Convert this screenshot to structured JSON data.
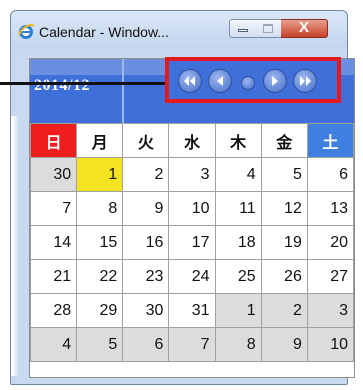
{
  "window": {
    "title": "Calendar - Window...",
    "controls": {
      "minimize": "minimize",
      "maximize": "maximize",
      "close": "X"
    }
  },
  "calendar": {
    "month_label": "2014/12",
    "nav": [
      "first-icon",
      "previous-icon",
      "today-dot-icon",
      "next-icon",
      "last-icon"
    ],
    "weekdays": [
      "日",
      "月",
      "火",
      "水",
      "木",
      "金",
      "土"
    ],
    "weeks": [
      [
        "30",
        "1",
        "2",
        "3",
        "4",
        "5",
        "6"
      ],
      [
        "7",
        "8",
        "9",
        "10",
        "11",
        "12",
        "13"
      ],
      [
        "14",
        "15",
        "16",
        "17",
        "18",
        "19",
        "20"
      ],
      [
        "21",
        "22",
        "23",
        "24",
        "25",
        "26",
        "27"
      ],
      [
        "28",
        "29",
        "30",
        "31",
        "1",
        "2",
        "3"
      ],
      [
        "4",
        "5",
        "6",
        "7",
        "8",
        "9",
        "10"
      ]
    ],
    "today": "1"
  },
  "colors": {
    "header": "#3f6fd8",
    "sunday": "#ef1d1d",
    "saturday": "#3e7fe0",
    "today": "#f3e322",
    "other_month": "#dcdcdc",
    "highlight_box": "#e4191f"
  }
}
